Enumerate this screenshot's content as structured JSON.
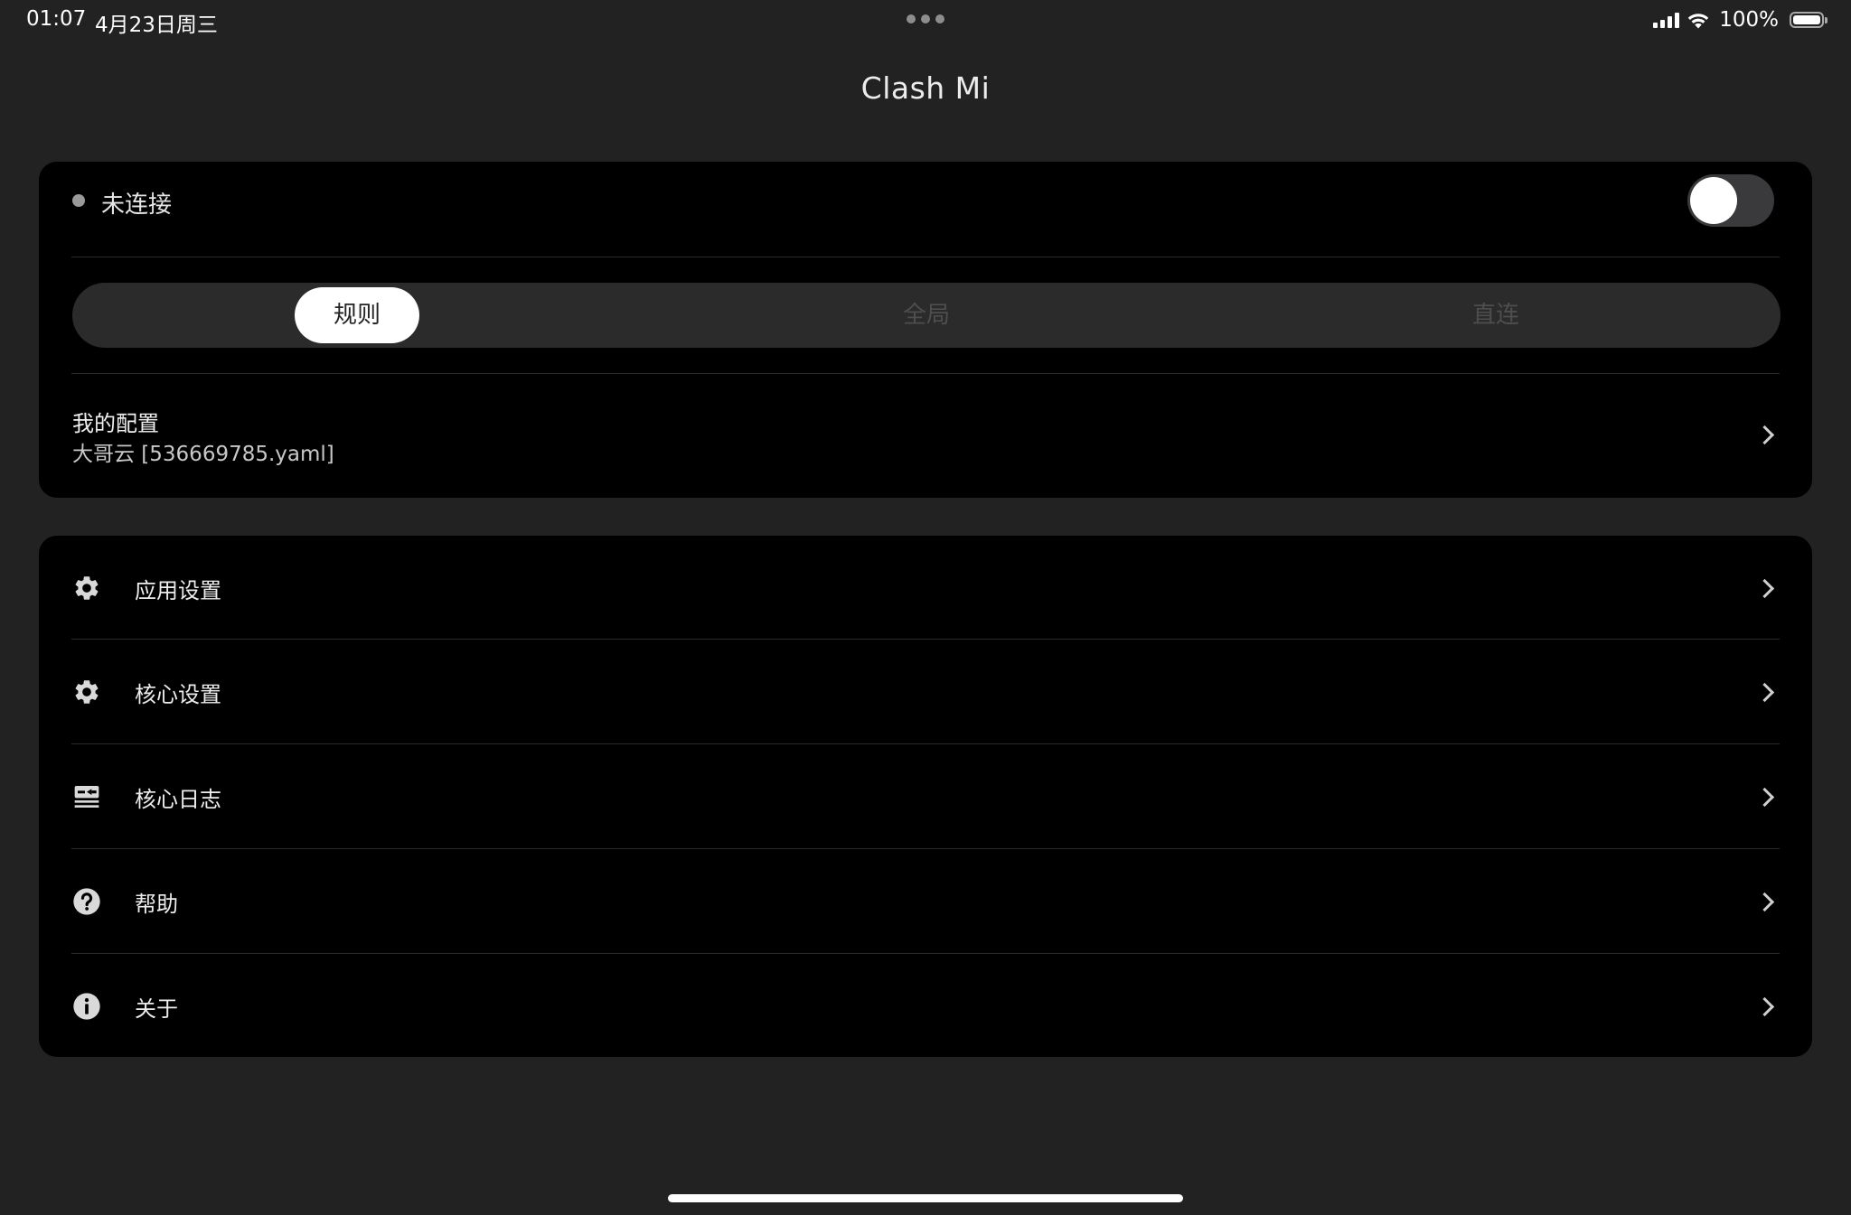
{
  "status_bar": {
    "time": "01:07",
    "date": "4月23日周三",
    "battery": "100%"
  },
  "title": "Clash Mi",
  "connection": {
    "status": "未连接",
    "enabled": false
  },
  "modes": {
    "items": [
      "规则",
      "全局",
      "直连"
    ],
    "selected": "规则"
  },
  "config": {
    "title": "我的配置",
    "subtitle": "大哥云 [536669785.yaml]"
  },
  "menu": {
    "items": [
      {
        "label": "应用设置",
        "icon": "gear-icon"
      },
      {
        "label": "核心设置",
        "icon": "gear-icon"
      },
      {
        "label": "核心日志",
        "icon": "log-icon"
      },
      {
        "label": "帮助",
        "icon": "help-icon"
      },
      {
        "label": "关于",
        "icon": "info-icon"
      }
    ]
  },
  "colors": {
    "background": "#222222",
    "card": "#000000",
    "text": "#ededed",
    "inactive_segment_text": "#4e4e4e"
  }
}
